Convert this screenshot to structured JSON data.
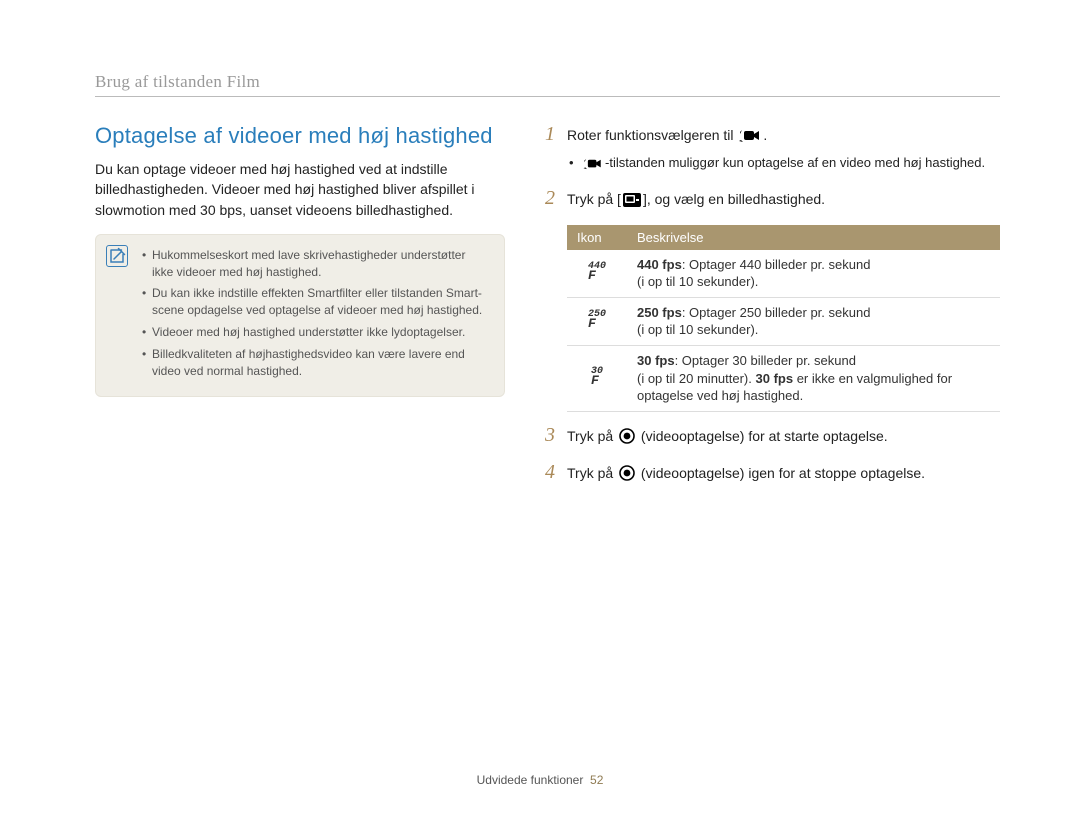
{
  "breadcrumb": "Brug af tilstanden Film",
  "left": {
    "title": "Optagelse af videoer med høj hastighed",
    "intro": "Du kan optage videoer med høj hastighed ved at indstille billedhastigheden. Videoer med høj hastighed bliver afspillet i slowmotion med 30 bps, uanset videoens billedhastighed.",
    "info": [
      "Hukommelseskort med lave skrivehastigheder understøtter ikke videoer med høj hastighed.",
      "Du kan ikke indstille effekten Smartfilter eller tilstanden Smart-scene opdagelse ved optagelse af videoer med høj hastighed.",
      "Videoer med høj hastighed understøtter ikke lydoptagelser.",
      "Billedkvaliteten af højhastighedsvideo kan være lavere end video ved normal hastighed."
    ]
  },
  "steps": {
    "s1": {
      "num": "1",
      "pre": "Roter funktionsvælgeren til ",
      "post": ".",
      "sub_pre": "",
      "sub_post": "-tilstanden muliggør kun optagelse af en video med høj hastighed."
    },
    "s2": {
      "num": "2",
      "pre": "Tryk på [",
      "post": "], og vælg en billedhastighed."
    },
    "s3": {
      "num": "3",
      "pre": "Tryk på ",
      "mid": " (videooptagelse) for at starte optagelse."
    },
    "s4": {
      "num": "4",
      "pre": "Tryk på ",
      "mid": " (videooptagelse) igen for at stoppe optagelse."
    }
  },
  "table": {
    "h_icon": "Ikon",
    "h_desc": "Beskrivelse",
    "r1": {
      "badge_top": "440",
      "lead": "440 fps",
      "rest": ": Optager 440 billeder pr. sekund",
      "note": "(i op til 10 sekunder)."
    },
    "r2": {
      "badge_top": "250",
      "lead": "250 fps",
      "rest": ": Optager 250 billeder pr. sekund",
      "note": "(i op til 10 sekunder)."
    },
    "r3": {
      "badge_top": "30",
      "lead": "30 fps",
      "rest": ": Optager 30 billeder pr. sekund",
      "note1": "(i op til 20 minutter). ",
      "lead2": "30 fps",
      "note2": " er ikke en valgmulighed for optagelse ved høj hastighed."
    }
  },
  "footer": {
    "text": "Udvidede funktioner",
    "page": "52"
  }
}
